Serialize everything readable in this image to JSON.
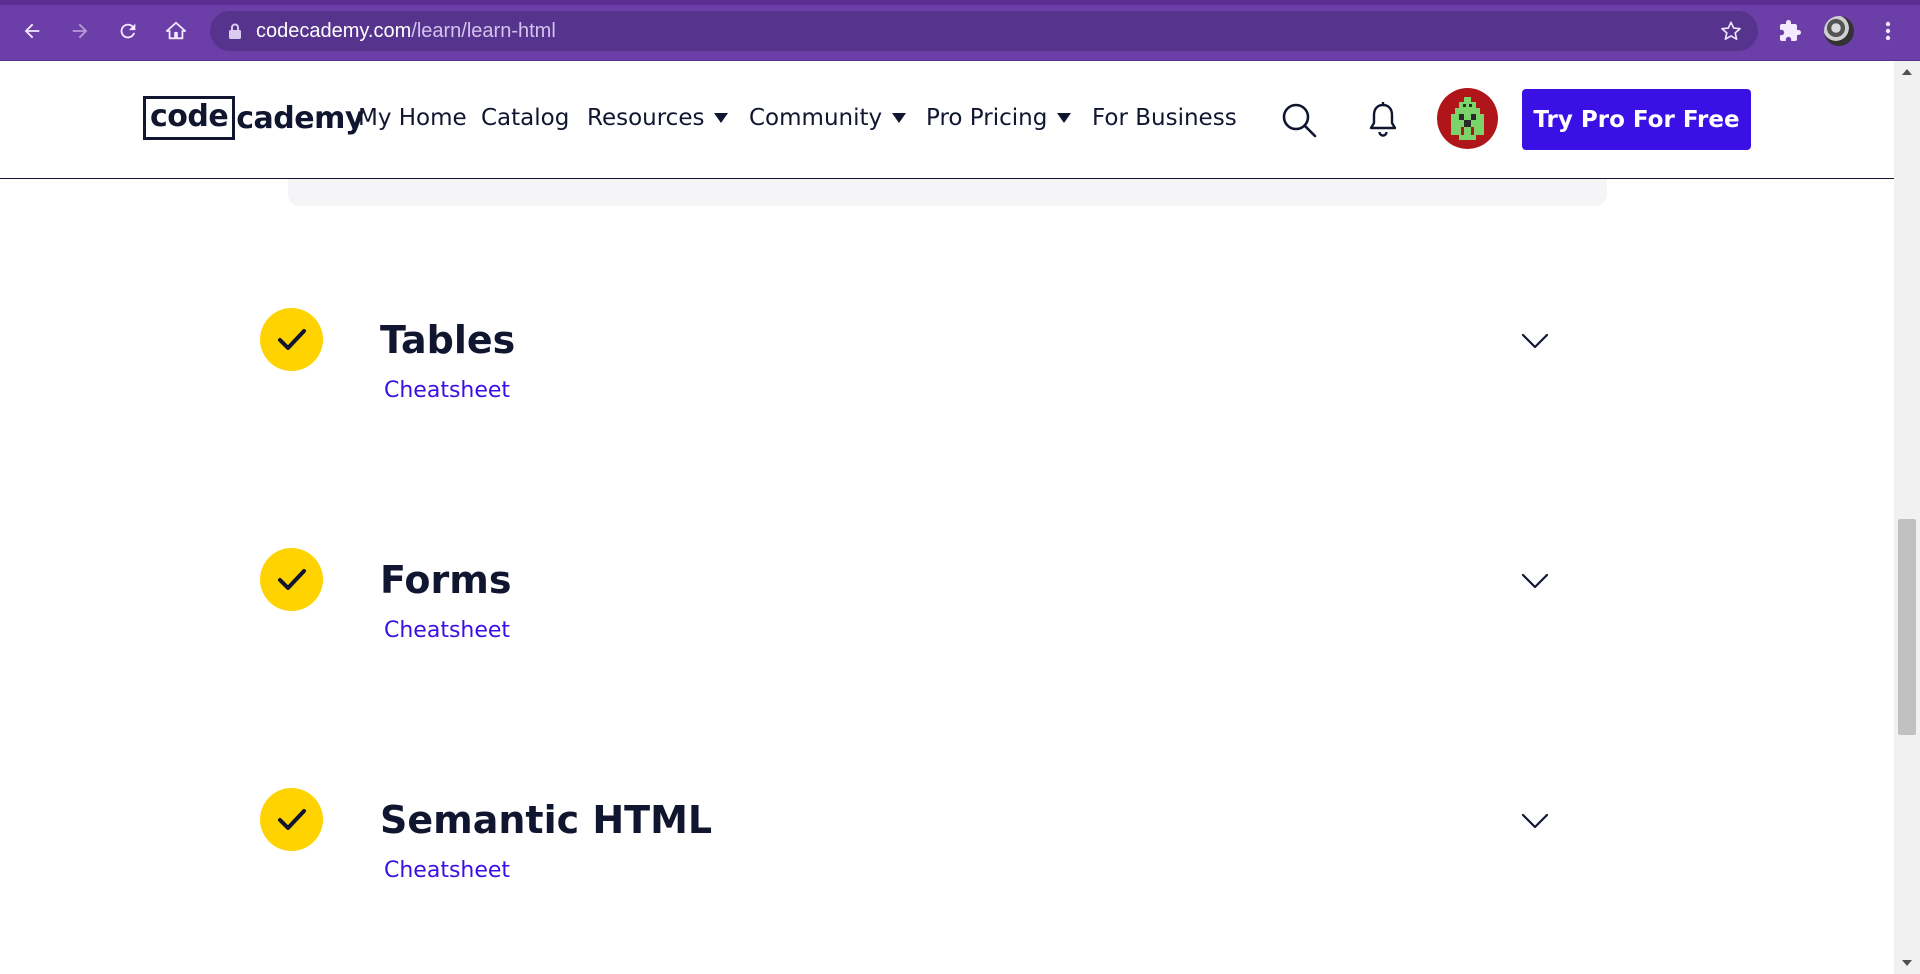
{
  "browser": {
    "url_host": "codecademy.com",
    "url_path": "/learn/learn-html",
    "icons": [
      "back-icon",
      "forward-icon",
      "reload-icon",
      "home-icon",
      "lock-icon",
      "star-icon",
      "extensions-icon",
      "profile-icon",
      "menu-icon"
    ]
  },
  "header": {
    "logo_left": "code",
    "logo_right": "cademy",
    "nav": [
      {
        "label": "My Home",
        "dropdown": false
      },
      {
        "label": "Catalog",
        "dropdown": false
      },
      {
        "label": "Resources",
        "dropdown": true
      },
      {
        "label": "Community",
        "dropdown": true
      },
      {
        "label": "Pro Pricing",
        "dropdown": true
      },
      {
        "label": "For Business",
        "dropdown": false
      }
    ],
    "cta_label": "Try Pro For Free",
    "cta_color": "#3a10e5"
  },
  "modules": [
    {
      "title": "Tables",
      "link": "Cheatsheet",
      "completed": true
    },
    {
      "title": "Forms",
      "link": "Cheatsheet",
      "completed": true
    },
    {
      "title": "Semantic HTML",
      "link": "Cheatsheet",
      "completed": true
    }
  ],
  "colors": {
    "browser_frame": "#6b3ea8",
    "check_badge": "#ffd300",
    "text_dark": "#10162f",
    "link": "#3a10e5"
  }
}
